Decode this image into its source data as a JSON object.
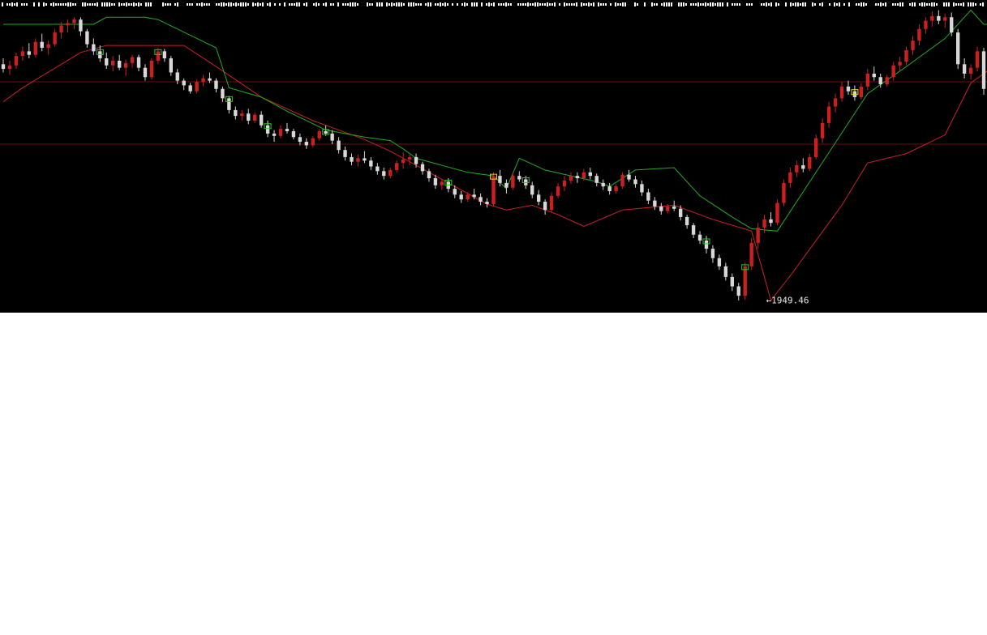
{
  "chart_data": {
    "type": "candlestick",
    "title": "",
    "xlabel": "",
    "ylabel": "",
    "grid": false,
    "legend": "none",
    "ylim": [
      1940,
      2160
    ],
    "reference_lines": [
      2135,
      2082
    ],
    "colors": {
      "background": "#000000",
      "up_candle": "#cc2020",
      "down_candle": "#d8d8d8",
      "upper_line": "#1fae1f",
      "lower_line": "#cc2020",
      "reference_line": "#6e1010",
      "top_dots": "#ffffff",
      "box_up": "#22cc22",
      "box_yellow": "#e8d020"
    },
    "candles": [
      {
        "o": 2150,
        "h": 2155,
        "l": 2143,
        "c": 2146
      },
      {
        "o": 2146,
        "h": 2153,
        "l": 2141,
        "c": 2149
      },
      {
        "o": 2149,
        "h": 2160,
        "l": 2146,
        "c": 2157
      },
      {
        "o": 2157,
        "h": 2165,
        "l": 2153,
        "c": 2161
      },
      {
        "o": 2161,
        "h": 2168,
        "l": 2155,
        "c": 2158
      },
      {
        "o": 2158,
        "h": 2172,
        "l": 2156,
        "c": 2169
      },
      {
        "o": 2169,
        "h": 2176,
        "l": 2161,
        "c": 2164
      },
      {
        "o": 2164,
        "h": 2170,
        "l": 2158,
        "c": 2167
      },
      {
        "o": 2167,
        "h": 2180,
        "l": 2165,
        "c": 2177
      },
      {
        "o": 2177,
        "h": 2186,
        "l": 2172,
        "c": 2183
      },
      {
        "o": 2183,
        "h": 2188,
        "l": 2177,
        "c": 2185
      },
      {
        "o": 2185,
        "h": 2190,
        "l": 2180,
        "c": 2188
      },
      {
        "o": 2188,
        "h": 2190,
        "l": 2174,
        "c": 2178
      },
      {
        "o": 2178,
        "h": 2180,
        "l": 2164,
        "c": 2167
      },
      {
        "o": 2167,
        "h": 2172,
        "l": 2158,
        "c": 2161
      },
      {
        "o": 2161,
        "h": 2166,
        "l": 2152,
        "c": 2155
      },
      {
        "o": 2155,
        "h": 2160,
        "l": 2146,
        "c": 2149
      },
      {
        "o": 2149,
        "h": 2157,
        "l": 2144,
        "c": 2153
      },
      {
        "o": 2153,
        "h": 2158,
        "l": 2145,
        "c": 2147
      },
      {
        "o": 2147,
        "h": 2154,
        "l": 2140,
        "c": 2151
      },
      {
        "o": 2151,
        "h": 2158,
        "l": 2147,
        "c": 2156
      },
      {
        "o": 2156,
        "h": 2158,
        "l": 2144,
        "c": 2147
      },
      {
        "o": 2147,
        "h": 2150,
        "l": 2136,
        "c": 2139
      },
      {
        "o": 2139,
        "h": 2155,
        "l": 2137,
        "c": 2153
      },
      {
        "o": 2153,
        "h": 2164,
        "l": 2150,
        "c": 2161
      },
      {
        "o": 2161,
        "h": 2163,
        "l": 2152,
        "c": 2155
      },
      {
        "o": 2155,
        "h": 2157,
        "l": 2140,
        "c": 2143
      },
      {
        "o": 2143,
        "h": 2146,
        "l": 2133,
        "c": 2136
      },
      {
        "o": 2136,
        "h": 2138,
        "l": 2128,
        "c": 2132
      },
      {
        "o": 2132,
        "h": 2134,
        "l": 2125,
        "c": 2127
      },
      {
        "o": 2127,
        "h": 2137,
        "l": 2125,
        "c": 2135
      },
      {
        "o": 2135,
        "h": 2141,
        "l": 2131,
        "c": 2138
      },
      {
        "o": 2138,
        "h": 2143,
        "l": 2134,
        "c": 2136
      },
      {
        "o": 2136,
        "h": 2138,
        "l": 2126,
        "c": 2129
      },
      {
        "o": 2129,
        "h": 2131,
        "l": 2118,
        "c": 2121
      },
      {
        "o": 2121,
        "h": 2123,
        "l": 2108,
        "c": 2111
      },
      {
        "o": 2111,
        "h": 2114,
        "l": 2103,
        "c": 2106
      },
      {
        "o": 2106,
        "h": 2111,
        "l": 2102,
        "c": 2108
      },
      {
        "o": 2108,
        "h": 2112,
        "l": 2099,
        "c": 2102
      },
      {
        "o": 2102,
        "h": 2109,
        "l": 2100,
        "c": 2107
      },
      {
        "o": 2107,
        "h": 2110,
        "l": 2096,
        "c": 2098
      },
      {
        "o": 2098,
        "h": 2102,
        "l": 2088,
        "c": 2091
      },
      {
        "o": 2091,
        "h": 2094,
        "l": 2084,
        "c": 2089
      },
      {
        "o": 2089,
        "h": 2098,
        "l": 2087,
        "c": 2095
      },
      {
        "o": 2095,
        "h": 2100,
        "l": 2091,
        "c": 2093
      },
      {
        "o": 2093,
        "h": 2095,
        "l": 2086,
        "c": 2088
      },
      {
        "o": 2088,
        "h": 2091,
        "l": 2081,
        "c": 2084
      },
      {
        "o": 2084,
        "h": 2087,
        "l": 2078,
        "c": 2081
      },
      {
        "o": 2081,
        "h": 2089,
        "l": 2079,
        "c": 2087
      },
      {
        "o": 2087,
        "h": 2095,
        "l": 2085,
        "c": 2093
      },
      {
        "o": 2093,
        "h": 2098,
        "l": 2089,
        "c": 2091
      },
      {
        "o": 2091,
        "h": 2094,
        "l": 2082,
        "c": 2085
      },
      {
        "o": 2085,
        "h": 2088,
        "l": 2074,
        "c": 2077
      },
      {
        "o": 2077,
        "h": 2080,
        "l": 2068,
        "c": 2071
      },
      {
        "o": 2071,
        "h": 2074,
        "l": 2064,
        "c": 2067
      },
      {
        "o": 2067,
        "h": 2073,
        "l": 2063,
        "c": 2070
      },
      {
        "o": 2070,
        "h": 2076,
        "l": 2066,
        "c": 2068
      },
      {
        "o": 2068,
        "h": 2071,
        "l": 2060,
        "c": 2063
      },
      {
        "o": 2063,
        "h": 2066,
        "l": 2056,
        "c": 2059
      },
      {
        "o": 2059,
        "h": 2062,
        "l": 2052,
        "c": 2055
      },
      {
        "o": 2055,
        "h": 2062,
        "l": 2053,
        "c": 2060
      },
      {
        "o": 2060,
        "h": 2068,
        "l": 2058,
        "c": 2066
      },
      {
        "o": 2066,
        "h": 2075,
        "l": 2061,
        "c": 2069
      },
      {
        "o": 2069,
        "h": 2073,
        "l": 2064,
        "c": 2071
      },
      {
        "o": 2071,
        "h": 2074,
        "l": 2062,
        "c": 2065
      },
      {
        "o": 2065,
        "h": 2067,
        "l": 2056,
        "c": 2059
      },
      {
        "o": 2059,
        "h": 2061,
        "l": 2050,
        "c": 2053
      },
      {
        "o": 2053,
        "h": 2056,
        "l": 2044,
        "c": 2047
      },
      {
        "o": 2047,
        "h": 2052,
        "l": 2043,
        "c": 2050
      },
      {
        "o": 2050,
        "h": 2053,
        "l": 2041,
        "c": 2044
      },
      {
        "o": 2044,
        "h": 2047,
        "l": 2036,
        "c": 2039
      },
      {
        "o": 2039,
        "h": 2042,
        "l": 2032,
        "c": 2035
      },
      {
        "o": 2035,
        "h": 2041,
        "l": 2033,
        "c": 2039
      },
      {
        "o": 2039,
        "h": 2044,
        "l": 2035,
        "c": 2037
      },
      {
        "o": 2037,
        "h": 2040,
        "l": 2030,
        "c": 2033
      },
      {
        "o": 2033,
        "h": 2036,
        "l": 2028,
        "c": 2031
      },
      {
        "o": 2031,
        "h": 2058,
        "l": 2029,
        "c": 2055
      },
      {
        "o": 2055,
        "h": 2060,
        "l": 2046,
        "c": 2049
      },
      {
        "o": 2049,
        "h": 2052,
        "l": 2040,
        "c": 2045
      },
      {
        "o": 2045,
        "h": 2058,
        "l": 2043,
        "c": 2055
      },
      {
        "o": 2055,
        "h": 2059,
        "l": 2050,
        "c": 2052
      },
      {
        "o": 2052,
        "h": 2055,
        "l": 2044,
        "c": 2047
      },
      {
        "o": 2047,
        "h": 2050,
        "l": 2036,
        "c": 2039
      },
      {
        "o": 2039,
        "h": 2043,
        "l": 2030,
        "c": 2033
      },
      {
        "o": 2033,
        "h": 2035,
        "l": 2022,
        "c": 2026
      },
      {
        "o": 2026,
        "h": 2041,
        "l": 2024,
        "c": 2038
      },
      {
        "o": 2038,
        "h": 2049,
        "l": 2036,
        "c": 2046
      },
      {
        "o": 2046,
        "h": 2055,
        "l": 2042,
        "c": 2051
      },
      {
        "o": 2051,
        "h": 2058,
        "l": 2048,
        "c": 2055
      },
      {
        "o": 2055,
        "h": 2058,
        "l": 2049,
        "c": 2053
      },
      {
        "o": 2053,
        "h": 2061,
        "l": 2051,
        "c": 2058
      },
      {
        "o": 2058,
        "h": 2062,
        "l": 2052,
        "c": 2055
      },
      {
        "o": 2055,
        "h": 2057,
        "l": 2046,
        "c": 2049
      },
      {
        "o": 2049,
        "h": 2052,
        "l": 2043,
        "c": 2046
      },
      {
        "o": 2046,
        "h": 2049,
        "l": 2039,
        "c": 2042
      },
      {
        "o": 2042,
        "h": 2048,
        "l": 2040,
        "c": 2046
      },
      {
        "o": 2046,
        "h": 2058,
        "l": 2044,
        "c": 2056
      },
      {
        "o": 2056,
        "h": 2060,
        "l": 2050,
        "c": 2052
      },
      {
        "o": 2052,
        "h": 2055,
        "l": 2045,
        "c": 2048
      },
      {
        "o": 2048,
        "h": 2051,
        "l": 2038,
        "c": 2041
      },
      {
        "o": 2041,
        "h": 2044,
        "l": 2031,
        "c": 2034
      },
      {
        "o": 2034,
        "h": 2037,
        "l": 2026,
        "c": 2029
      },
      {
        "o": 2029,
        "h": 2032,
        "l": 2022,
        "c": 2025
      },
      {
        "o": 2025,
        "h": 2031,
        "l": 2023,
        "c": 2029
      },
      {
        "o": 2029,
        "h": 2034,
        "l": 2025,
        "c": 2027
      },
      {
        "o": 2027,
        "h": 2030,
        "l": 2017,
        "c": 2020
      },
      {
        "o": 2020,
        "h": 2022,
        "l": 2010,
        "c": 2013
      },
      {
        "o": 2013,
        "h": 2015,
        "l": 2002,
        "c": 2005
      },
      {
        "o": 2005,
        "h": 2008,
        "l": 1997,
        "c": 2000
      },
      {
        "o": 2000,
        "h": 2004,
        "l": 1989,
        "c": 1993
      },
      {
        "o": 1993,
        "h": 1996,
        "l": 1981,
        "c": 1985
      },
      {
        "o": 1985,
        "h": 1988,
        "l": 1975,
        "c": 1978
      },
      {
        "o": 1978,
        "h": 1981,
        "l": 1966,
        "c": 1969
      },
      {
        "o": 1969,
        "h": 1972,
        "l": 1957,
        "c": 1961
      },
      {
        "o": 1961,
        "h": 1964,
        "l": 1949,
        "c": 1953
      },
      {
        "o": 1953,
        "h": 1981,
        "l": 1949.46,
        "c": 1978
      },
      {
        "o": 1978,
        "h": 2002,
        "l": 1975,
        "c": 1998
      },
      {
        "o": 1998,
        "h": 2015,
        "l": 1993,
        "c": 2011
      },
      {
        "o": 2011,
        "h": 2022,
        "l": 2006,
        "c": 2018
      },
      {
        "o": 2018,
        "h": 2024,
        "l": 2012,
        "c": 2015
      },
      {
        "o": 2015,
        "h": 2035,
        "l": 2013,
        "c": 2032
      },
      {
        "o": 2032,
        "h": 2052,
        "l": 2029,
        "c": 2049
      },
      {
        "o": 2049,
        "h": 2062,
        "l": 2045,
        "c": 2058
      },
      {
        "o": 2058,
        "h": 2068,
        "l": 2054,
        "c": 2064
      },
      {
        "o": 2064,
        "h": 2070,
        "l": 2058,
        "c": 2061
      },
      {
        "o": 2061,
        "h": 2074,
        "l": 2059,
        "c": 2071
      },
      {
        "o": 2071,
        "h": 2090,
        "l": 2069,
        "c": 2087
      },
      {
        "o": 2087,
        "h": 2104,
        "l": 2083,
        "c": 2100
      },
      {
        "o": 2100,
        "h": 2118,
        "l": 2096,
        "c": 2114
      },
      {
        "o": 2114,
        "h": 2125,
        "l": 2109,
        "c": 2121
      },
      {
        "o": 2121,
        "h": 2135,
        "l": 2118,
        "c": 2131
      },
      {
        "o": 2131,
        "h": 2136,
        "l": 2124,
        "c": 2127
      },
      {
        "o": 2127,
        "h": 2132,
        "l": 2119,
        "c": 2122
      },
      {
        "o": 2122,
        "h": 2134,
        "l": 2120,
        "c": 2131
      },
      {
        "o": 2131,
        "h": 2146,
        "l": 2128,
        "c": 2142
      },
      {
        "o": 2142,
        "h": 2148,
        "l": 2136,
        "c": 2139
      },
      {
        "o": 2139,
        "h": 2142,
        "l": 2130,
        "c": 2133
      },
      {
        "o": 2133,
        "h": 2141,
        "l": 2131,
        "c": 2139
      },
      {
        "o": 2139,
        "h": 2152,
        "l": 2136,
        "c": 2149
      },
      {
        "o": 2149,
        "h": 2156,
        "l": 2144,
        "c": 2152
      },
      {
        "o": 2152,
        "h": 2165,
        "l": 2149,
        "c": 2162
      },
      {
        "o": 2162,
        "h": 2174,
        "l": 2158,
        "c": 2170
      },
      {
        "o": 2170,
        "h": 2184,
        "l": 2166,
        "c": 2180
      },
      {
        "o": 2180,
        "h": 2190,
        "l": 2176,
        "c": 2187
      },
      {
        "o": 2187,
        "h": 2195,
        "l": 2182,
        "c": 2191
      },
      {
        "o": 2191,
        "h": 2196,
        "l": 2184,
        "c": 2187
      },
      {
        "o": 2187,
        "h": 2193,
        "l": 2181,
        "c": 2190
      },
      {
        "o": 2190,
        "h": 2194,
        "l": 2174,
        "c": 2177
      },
      {
        "o": 2177,
        "h": 2180,
        "l": 2146,
        "c": 2150
      },
      {
        "o": 2150,
        "h": 2155,
        "l": 2138,
        "c": 2142
      },
      {
        "o": 2142,
        "h": 2150,
        "l": 2137,
        "c": 2147
      },
      {
        "o": 2147,
        "h": 2165,
        "l": 2144,
        "c": 2161
      },
      {
        "o": 2161,
        "h": 2164,
        "l": 2124,
        "c": 2129
      }
    ],
    "upper_line": [
      {
        "i": 0,
        "v": 2184
      },
      {
        "i": 14,
        "v": 2184
      },
      {
        "i": 16,
        "v": 2190
      },
      {
        "i": 22,
        "v": 2190
      },
      {
        "i": 24,
        "v": 2188
      },
      {
        "i": 33,
        "v": 2164
      },
      {
        "i": 35,
        "v": 2130
      },
      {
        "i": 40,
        "v": 2122
      },
      {
        "i": 44,
        "v": 2110
      },
      {
        "i": 50,
        "v": 2094
      },
      {
        "i": 56,
        "v": 2088
      },
      {
        "i": 60,
        "v": 2085
      },
      {
        "i": 62,
        "v": 2078
      },
      {
        "i": 64,
        "v": 2070
      },
      {
        "i": 72,
        "v": 2058
      },
      {
        "i": 76,
        "v": 2055
      },
      {
        "i": 78,
        "v": 2044
      },
      {
        "i": 80,
        "v": 2070
      },
      {
        "i": 84,
        "v": 2060
      },
      {
        "i": 92,
        "v": 2050
      },
      {
        "i": 94,
        "v": 2046
      },
      {
        "i": 98,
        "v": 2060
      },
      {
        "i": 104,
        "v": 2062
      },
      {
        "i": 108,
        "v": 2038
      },
      {
        "i": 113,
        "v": 2020
      },
      {
        "i": 116,
        "v": 2010
      },
      {
        "i": 120,
        "v": 2008
      },
      {
        "i": 134,
        "v": 2125
      },
      {
        "i": 140,
        "v": 2148
      },
      {
        "i": 146,
        "v": 2172
      },
      {
        "i": 150,
        "v": 2196
      },
      {
        "i": 152,
        "v": 2184
      },
      {
        "i": 156,
        "v": 2184
      },
      {
        "i": 160,
        "v": 2176
      }
    ],
    "lower_line": [
      {
        "i": 0,
        "v": 2118
      },
      {
        "i": 3,
        "v": 2130
      },
      {
        "i": 6,
        "v": 2140
      },
      {
        "i": 9,
        "v": 2150
      },
      {
        "i": 12,
        "v": 2160
      },
      {
        "i": 16,
        "v": 2166
      },
      {
        "i": 24,
        "v": 2166
      },
      {
        "i": 28,
        "v": 2166
      },
      {
        "i": 33,
        "v": 2148
      },
      {
        "i": 40,
        "v": 2122
      },
      {
        "i": 48,
        "v": 2102
      },
      {
        "i": 56,
        "v": 2086
      },
      {
        "i": 60,
        "v": 2076
      },
      {
        "i": 64,
        "v": 2064
      },
      {
        "i": 70,
        "v": 2046
      },
      {
        "i": 75,
        "v": 2031
      },
      {
        "i": 78,
        "v": 2026
      },
      {
        "i": 82,
        "v": 2030
      },
      {
        "i": 86,
        "v": 2022
      },
      {
        "i": 90,
        "v": 2012
      },
      {
        "i": 96,
        "v": 2026
      },
      {
        "i": 104,
        "v": 2030
      },
      {
        "i": 110,
        "v": 2018
      },
      {
        "i": 116,
        "v": 2008
      },
      {
        "i": 119,
        "v": 1949
      },
      {
        "i": 122,
        "v": 1970
      },
      {
        "i": 126,
        "v": 2000
      },
      {
        "i": 130,
        "v": 2030
      },
      {
        "i": 134,
        "v": 2066
      },
      {
        "i": 140,
        "v": 2074
      },
      {
        "i": 146,
        "v": 2090
      },
      {
        "i": 150,
        "v": 2134
      },
      {
        "i": 154,
        "v": 2150
      },
      {
        "i": 158,
        "v": 2156
      },
      {
        "i": 160,
        "v": 2158
      }
    ],
    "box_markers": [
      {
        "i": 15,
        "kind": "green"
      },
      {
        "i": 24,
        "kind": "green"
      },
      {
        "i": 35,
        "kind": "green"
      },
      {
        "i": 41,
        "kind": "green"
      },
      {
        "i": 50,
        "kind": "green"
      },
      {
        "i": 69,
        "kind": "green"
      },
      {
        "i": 81,
        "kind": "green"
      },
      {
        "i": 109,
        "kind": "green"
      },
      {
        "i": 115,
        "kind": "green"
      },
      {
        "i": 76,
        "kind": "yellow"
      },
      {
        "i": 132,
        "kind": "yellow"
      }
    ],
    "annotations": [
      {
        "i": 118,
        "value": 1949.46,
        "text": "←1949.46"
      }
    ]
  }
}
